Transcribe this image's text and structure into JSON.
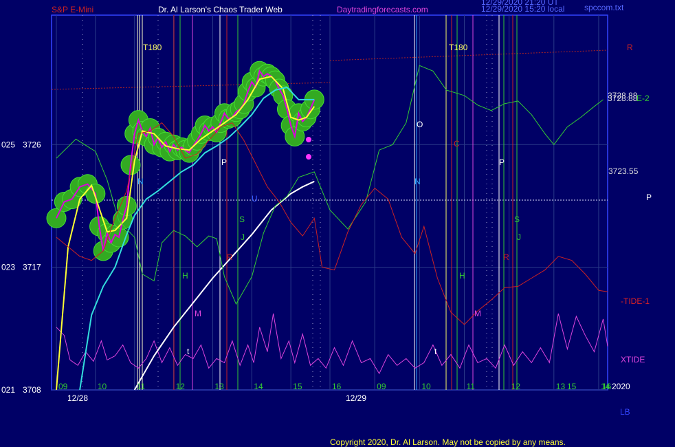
{
  "header": {
    "symbol": "S&P E-Mini",
    "title": "Dr. Al Larson's Chaos Trader Web",
    "site": "Daytradingforecasts.com",
    "stamp_1": "12/29/2020 21:20 UT",
    "stamp_2": "12/29/2020 15:20 local",
    "file": "spccom.txt"
  },
  "footer": {
    "copyright": "Copyright 2020, Dr. Al Larson. May not be copied by any means."
  },
  "chart_data": {
    "type": "line",
    "y_axis": {
      "ylim": [
        3708,
        3735.5
      ],
      "ticks": [
        {
          "left": "025",
          "value": 3726
        },
        {
          "left": "023",
          "value": 3717
        },
        {
          "left": "021",
          "value": 3708
        }
      ]
    },
    "x_axis": {
      "hour_labels": [
        "09",
        "10",
        "11",
        "12",
        "13",
        "14",
        "15",
        "16",
        "09",
        "10",
        "11",
        "12",
        "13",
        "14",
        "15",
        "16"
      ],
      "date_labels": [
        "12/28",
        "12/29"
      ],
      "year_label": "2020",
      "lb_label": "LB"
    },
    "right_labels": [
      {
        "text": "R",
        "color": "#cc2222"
      },
      {
        "text": "3728.88",
        "color": "#dddddd"
      },
      {
        "text": "3728.88",
        "color": "#dddddd"
      },
      {
        "text": "E-2",
        "color": "#33cc33"
      },
      {
        "text": "3723.55",
        "color": "#dddddd"
      },
      {
        "text": "P",
        "color": "#ffffff"
      },
      {
        "text": "-TIDE-1",
        "color": "#dd2222"
      },
      {
        "text": "XTIDE",
        "color": "#dd44dd"
      }
    ],
    "level_label": "3723.55",
    "markers": [
      {
        "text": "T180",
        "color": "#ffff66"
      },
      {
        "text": "T180",
        "color": "#ffff66"
      },
      {
        "text": "N",
        "color": "#33aaff"
      },
      {
        "text": "N",
        "color": "#33aaff"
      },
      {
        "text": "P",
        "color": "#ffffff"
      },
      {
        "text": "P",
        "color": "#ffffff"
      },
      {
        "text": "S",
        "color": "#33cc33"
      },
      {
        "text": "S",
        "color": "#33cc33"
      },
      {
        "text": "J",
        "color": "#33cc33"
      },
      {
        "text": "J",
        "color": "#33cc33"
      },
      {
        "text": "H",
        "color": "#33cc33"
      },
      {
        "text": "H",
        "color": "#33cc33"
      },
      {
        "text": "R",
        "color": "#cc2222"
      },
      {
        "text": "R",
        "color": "#cc2222"
      },
      {
        "text": "M",
        "color": "#dd44dd"
      },
      {
        "text": "M",
        "color": "#dd44dd"
      },
      {
        "text": "O",
        "color": "#ffffff"
      },
      {
        "text": "C",
        "color": "#cc2222"
      },
      {
        "text": "U",
        "color": "#3355ff"
      },
      {
        "text": "t",
        "color": "#ffffff"
      },
      {
        "text": "t",
        "color": "#ffffff"
      }
    ],
    "series": [
      {
        "name": "",
        "color": "#dd00dd",
        "points": [
          [
            9.0,
            3720.6
          ],
          [
            9.2,
            3721.8
          ],
          [
            9.4,
            3722.0
          ],
          [
            9.6,
            3722.9
          ],
          [
            9.8,
            3723.1
          ],
          [
            10.0,
            3722.4
          ],
          [
            10.1,
            3720.0
          ],
          [
            10.2,
            3718.2
          ],
          [
            10.3,
            3719.5
          ],
          [
            10.4,
            3718.8
          ],
          [
            10.5,
            3719.4
          ],
          [
            10.6,
            3719.2
          ],
          [
            10.7,
            3720.5
          ],
          [
            10.8,
            3721.5
          ],
          [
            10.9,
            3724.5
          ],
          [
            11.0,
            3726.8
          ],
          [
            11.1,
            3727.8
          ],
          [
            11.2,
            3727.0
          ],
          [
            11.3,
            3726.6
          ],
          [
            11.4,
            3727.2
          ],
          [
            11.5,
            3726.0
          ],
          [
            11.6,
            3726.5
          ],
          [
            11.7,
            3725.8
          ],
          [
            11.8,
            3726.2
          ],
          [
            11.9,
            3725.5
          ],
          [
            12.0,
            3726.0
          ],
          [
            12.1,
            3725.6
          ],
          [
            12.2,
            3725.8
          ],
          [
            12.3,
            3725.6
          ],
          [
            12.4,
            3725.4
          ],
          [
            12.5,
            3725.9
          ],
          [
            12.6,
            3726.3
          ],
          [
            12.7,
            3726.8
          ],
          [
            12.8,
            3727.4
          ],
          [
            12.9,
            3727.0
          ],
          [
            13.0,
            3727.3
          ],
          [
            13.1,
            3726.9
          ],
          [
            13.2,
            3727.6
          ],
          [
            13.3,
            3728.3
          ],
          [
            13.4,
            3727.9
          ],
          [
            13.5,
            3728.0
          ],
          [
            13.6,
            3728.4
          ],
          [
            13.7,
            3728.6
          ],
          [
            13.8,
            3729.0
          ],
          [
            13.9,
            3729.9
          ],
          [
            14.0,
            3730.6
          ],
          [
            14.1,
            3730.2
          ],
          [
            14.2,
            3731.4
          ],
          [
            14.3,
            3731.0
          ],
          [
            14.4,
            3731.2
          ],
          [
            14.5,
            3731.0
          ],
          [
            14.6,
            3730.7
          ],
          [
            14.7,
            3730.1
          ],
          [
            14.8,
            3729.6
          ],
          [
            14.9,
            3728.6
          ],
          [
            15.0,
            3727.4
          ],
          [
            15.1,
            3726.6
          ],
          [
            15.2,
            3728.3
          ],
          [
            15.3,
            3727.7
          ],
          [
            15.4,
            3728.0
          ],
          [
            15.5,
            3728.6
          ],
          [
            15.6,
            3729.3
          ]
        ]
      },
      {
        "name": "",
        "color": "#ffff33",
        "points": [
          [
            9.0,
            3708.0
          ],
          [
            9.3,
            3718.5
          ],
          [
            9.6,
            3722.0
          ],
          [
            9.9,
            3723.0
          ],
          [
            10.1,
            3721.3
          ],
          [
            10.3,
            3719.6
          ],
          [
            10.5,
            3719.7
          ],
          [
            10.8,
            3720.6
          ],
          [
            11.0,
            3724.8
          ],
          [
            11.2,
            3727.0
          ],
          [
            11.5,
            3726.8
          ],
          [
            11.8,
            3725.9
          ],
          [
            12.1,
            3725.7
          ],
          [
            12.4,
            3725.6
          ],
          [
            12.7,
            3726.4
          ],
          [
            13.0,
            3727.0
          ],
          [
            13.3,
            3727.6
          ],
          [
            13.6,
            3728.2
          ],
          [
            13.9,
            3729.3
          ],
          [
            14.2,
            3730.8
          ],
          [
            14.5,
            3731.0
          ],
          [
            14.8,
            3730.1
          ],
          [
            15.0,
            3728.0
          ],
          [
            15.2,
            3727.8
          ],
          [
            15.4,
            3728.0
          ],
          [
            15.6,
            3728.8
          ]
        ]
      },
      {
        "name": "",
        "color": "#33dddd",
        "points": [
          [
            9.6,
            3708.0
          ],
          [
            9.9,
            3713.5
          ],
          [
            10.2,
            3715.6
          ],
          [
            10.5,
            3717.0
          ],
          [
            10.8,
            3719.4
          ],
          [
            11.0,
            3720.8
          ],
          [
            11.3,
            3722.0
          ],
          [
            11.6,
            3722.6
          ],
          [
            11.9,
            3723.3
          ],
          [
            12.2,
            3724.0
          ],
          [
            12.5,
            3724.5
          ],
          [
            12.8,
            3725.4
          ],
          [
            13.1,
            3725.9
          ],
          [
            13.4,
            3726.5
          ],
          [
            13.7,
            3727.3
          ],
          [
            14.0,
            3728.2
          ],
          [
            14.3,
            3729.4
          ],
          [
            14.6,
            3730.0
          ],
          [
            14.9,
            3730.2
          ],
          [
            15.2,
            3729.3
          ],
          [
            15.6,
            3729.3
          ]
        ]
      },
      {
        "name": "",
        "color": "#ffffff",
        "points": [
          [
            11.0,
            3708.0
          ],
          [
            11.5,
            3710.5
          ],
          [
            12.0,
            3712.6
          ],
          [
            12.5,
            3714.4
          ],
          [
            13.0,
            3716.2
          ],
          [
            13.5,
            3717.8
          ],
          [
            14.0,
            3719.4
          ],
          [
            14.5,
            3721.2
          ],
          [
            15.0,
            3722.4
          ],
          [
            15.3,
            3722.9
          ],
          [
            15.6,
            3723.3
          ]
        ]
      },
      {
        "name": "",
        "color": "#33cc33",
        "points": [
          [
            9.0,
            3725.0
          ],
          [
            9.5,
            3726.4
          ],
          [
            10.0,
            3725.5
          ],
          [
            10.3,
            3723.4
          ],
          [
            10.6,
            3720.4
          ],
          [
            11.0,
            3719.2
          ],
          [
            11.2,
            3716.5
          ],
          [
            11.5,
            3716.0
          ],
          [
            11.7,
            3718.8
          ],
          [
            12.0,
            3719.7
          ],
          [
            12.3,
            3719.3
          ],
          [
            12.6,
            3718.5
          ],
          [
            12.9,
            3719.3
          ],
          [
            13.1,
            3719.1
          ],
          [
            13.3,
            3716.3
          ],
          [
            13.6,
            3714.3
          ],
          [
            14.0,
            3716.3
          ],
          [
            14.3,
            3719.5
          ],
          [
            14.6,
            3721.5
          ],
          [
            14.9,
            3722.2
          ],
          [
            15.2,
            3723.6
          ],
          [
            15.6,
            3724.0
          ],
          [
            16.0,
            3721.2
          ],
          [
            16.4,
            3719.8
          ],
          [
            16.8,
            3721.8
          ],
          [
            17.1,
            3725.6
          ],
          [
            17.4,
            3726.0
          ],
          [
            17.7,
            3727.6
          ],
          [
            18.0,
            3731.8
          ],
          [
            18.3,
            3731.4
          ],
          [
            18.6,
            3730.0
          ],
          [
            19.0,
            3729.6
          ],
          [
            19.3,
            3728.9
          ],
          [
            19.6,
            3728.5
          ],
          [
            19.9,
            3729.0
          ],
          [
            20.2,
            3729.2
          ],
          [
            20.5,
            3728.2
          ],
          [
            20.8,
            3726.8
          ],
          [
            21.0,
            3726.0
          ],
          [
            21.3,
            3727.3
          ],
          [
            21.6,
            3728.0
          ],
          [
            21.9,
            3728.8
          ],
          [
            22.1,
            3729.3
          ]
        ]
      },
      {
        "name": "",
        "color": "#cc2222",
        "points": [
          [
            9.0,
            3719.2
          ],
          [
            9.3,
            3718.5
          ],
          [
            9.6,
            3717.8
          ],
          [
            9.9,
            3717.5
          ],
          [
            10.2,
            3718.2
          ],
          [
            10.5,
            3720.6
          ],
          [
            10.8,
            3722.6
          ],
          [
            11.1,
            3726.8
          ],
          [
            11.4,
            3727.0
          ],
          [
            11.7,
            3727.6
          ],
          [
            12.0,
            3726.6
          ],
          [
            12.3,
            3725.0
          ],
          [
            12.6,
            3725.3
          ],
          [
            12.9,
            3726.3
          ],
          [
            13.2,
            3727.3
          ],
          [
            13.5,
            3727.6
          ],
          [
            13.8,
            3726.3
          ],
          [
            14.1,
            3724.6
          ],
          [
            14.4,
            3722.9
          ],
          [
            14.7,
            3721.8
          ],
          [
            15.0,
            3720.3
          ],
          [
            15.3,
            3719.3
          ],
          [
            15.6,
            3720.6
          ],
          [
            15.8,
            3717.0
          ],
          [
            16.1,
            3716.8
          ],
          [
            16.4,
            3719.6
          ],
          [
            16.7,
            3721.6
          ],
          [
            17.0,
            3722.8
          ],
          [
            17.3,
            3722.0
          ],
          [
            17.6,
            3719.2
          ],
          [
            17.9,
            3718.0
          ],
          [
            18.1,
            3720.0
          ],
          [
            18.4,
            3716.2
          ],
          [
            18.7,
            3713.7
          ],
          [
            19.0,
            3712.8
          ],
          [
            19.3,
            3713.8
          ],
          [
            19.6,
            3714.6
          ],
          [
            19.9,
            3715.5
          ],
          [
            20.2,
            3715.6
          ],
          [
            20.5,
            3716.2
          ],
          [
            20.8,
            3716.8
          ],
          [
            21.1,
            3717.8
          ],
          [
            21.4,
            3717.5
          ],
          [
            21.7,
            3716.5
          ],
          [
            22.0,
            3715.3
          ],
          [
            22.2,
            3715.2
          ]
        ]
      }
    ],
    "xtide": [
      [
        9.0,
        3712.6
      ],
      [
        9.2,
        3712.0
      ],
      [
        9.35,
        3710.2
      ],
      [
        9.55,
        3709.8
      ],
      [
        9.75,
        3710.8
      ],
      [
        9.95,
        3710.1
      ],
      [
        10.15,
        3711.6
      ],
      [
        10.3,
        3710.2
      ],
      [
        10.5,
        3710.5
      ],
      [
        10.7,
        3711.3
      ],
      [
        10.9,
        3710.0
      ],
      [
        11.1,
        3709.6
      ],
      [
        11.3,
        3710.3
      ],
      [
        11.5,
        3711.6
      ],
      [
        11.7,
        3710.0
      ],
      [
        11.9,
        3711.1
      ],
      [
        12.1,
        3709.8
      ],
      [
        12.3,
        3710.6
      ],
      [
        12.5,
        3710.3
      ],
      [
        12.7,
        3711.3
      ],
      [
        12.9,
        3709.6
      ],
      [
        13.1,
        3710.3
      ],
      [
        13.3,
        3710.0
      ],
      [
        13.5,
        3711.6
      ],
      [
        13.7,
        3709.8
      ],
      [
        13.9,
        3711.3
      ],
      [
        14.05,
        3710.0
      ],
      [
        14.2,
        3712.6
      ],
      [
        14.4,
        3710.8
      ],
      [
        14.55,
        3713.6
      ],
      [
        14.75,
        3710.3
      ],
      [
        14.95,
        3711.6
      ],
      [
        15.1,
        3710.0
      ],
      [
        15.3,
        3712.1
      ],
      [
        15.5,
        3709.8
      ],
      [
        15.7,
        3710.3
      ],
      [
        15.9,
        3709.6
      ],
      [
        16.1,
        3711.1
      ],
      [
        16.3,
        3709.8
      ],
      [
        16.5,
        3711.6
      ],
      [
        16.7,
        3710.0
      ],
      [
        16.9,
        3710.3
      ],
      [
        17.1,
        3709.2
      ],
      [
        17.3,
        3710.6
      ],
      [
        17.5,
        3709.8
      ],
      [
        17.7,
        3710.3
      ],
      [
        17.9,
        3709.6
      ],
      [
        18.1,
        3710.0
      ],
      [
        18.3,
        3711.3
      ],
      [
        18.5,
        3709.8
      ],
      [
        18.7,
        3710.6
      ],
      [
        18.9,
        3709.6
      ],
      [
        19.1,
        3711.3
      ],
      [
        19.3,
        3710.0
      ],
      [
        19.5,
        3710.3
      ],
      [
        19.7,
        3709.6
      ],
      [
        19.9,
        3711.3
      ],
      [
        20.1,
        3709.8
      ],
      [
        20.3,
        3710.8
      ],
      [
        20.5,
        3710.0
      ],
      [
        20.7,
        3711.1
      ],
      [
        20.9,
        3710.0
      ],
      [
        21.1,
        3713.6
      ],
      [
        21.3,
        3711.0
      ],
      [
        21.5,
        3713.4
      ],
      [
        21.7,
        3712.0
      ],
      [
        21.9,
        3710.8
      ],
      [
        22.1,
        3713.2
      ],
      [
        22.2,
        3711.2
      ]
    ]
  }
}
